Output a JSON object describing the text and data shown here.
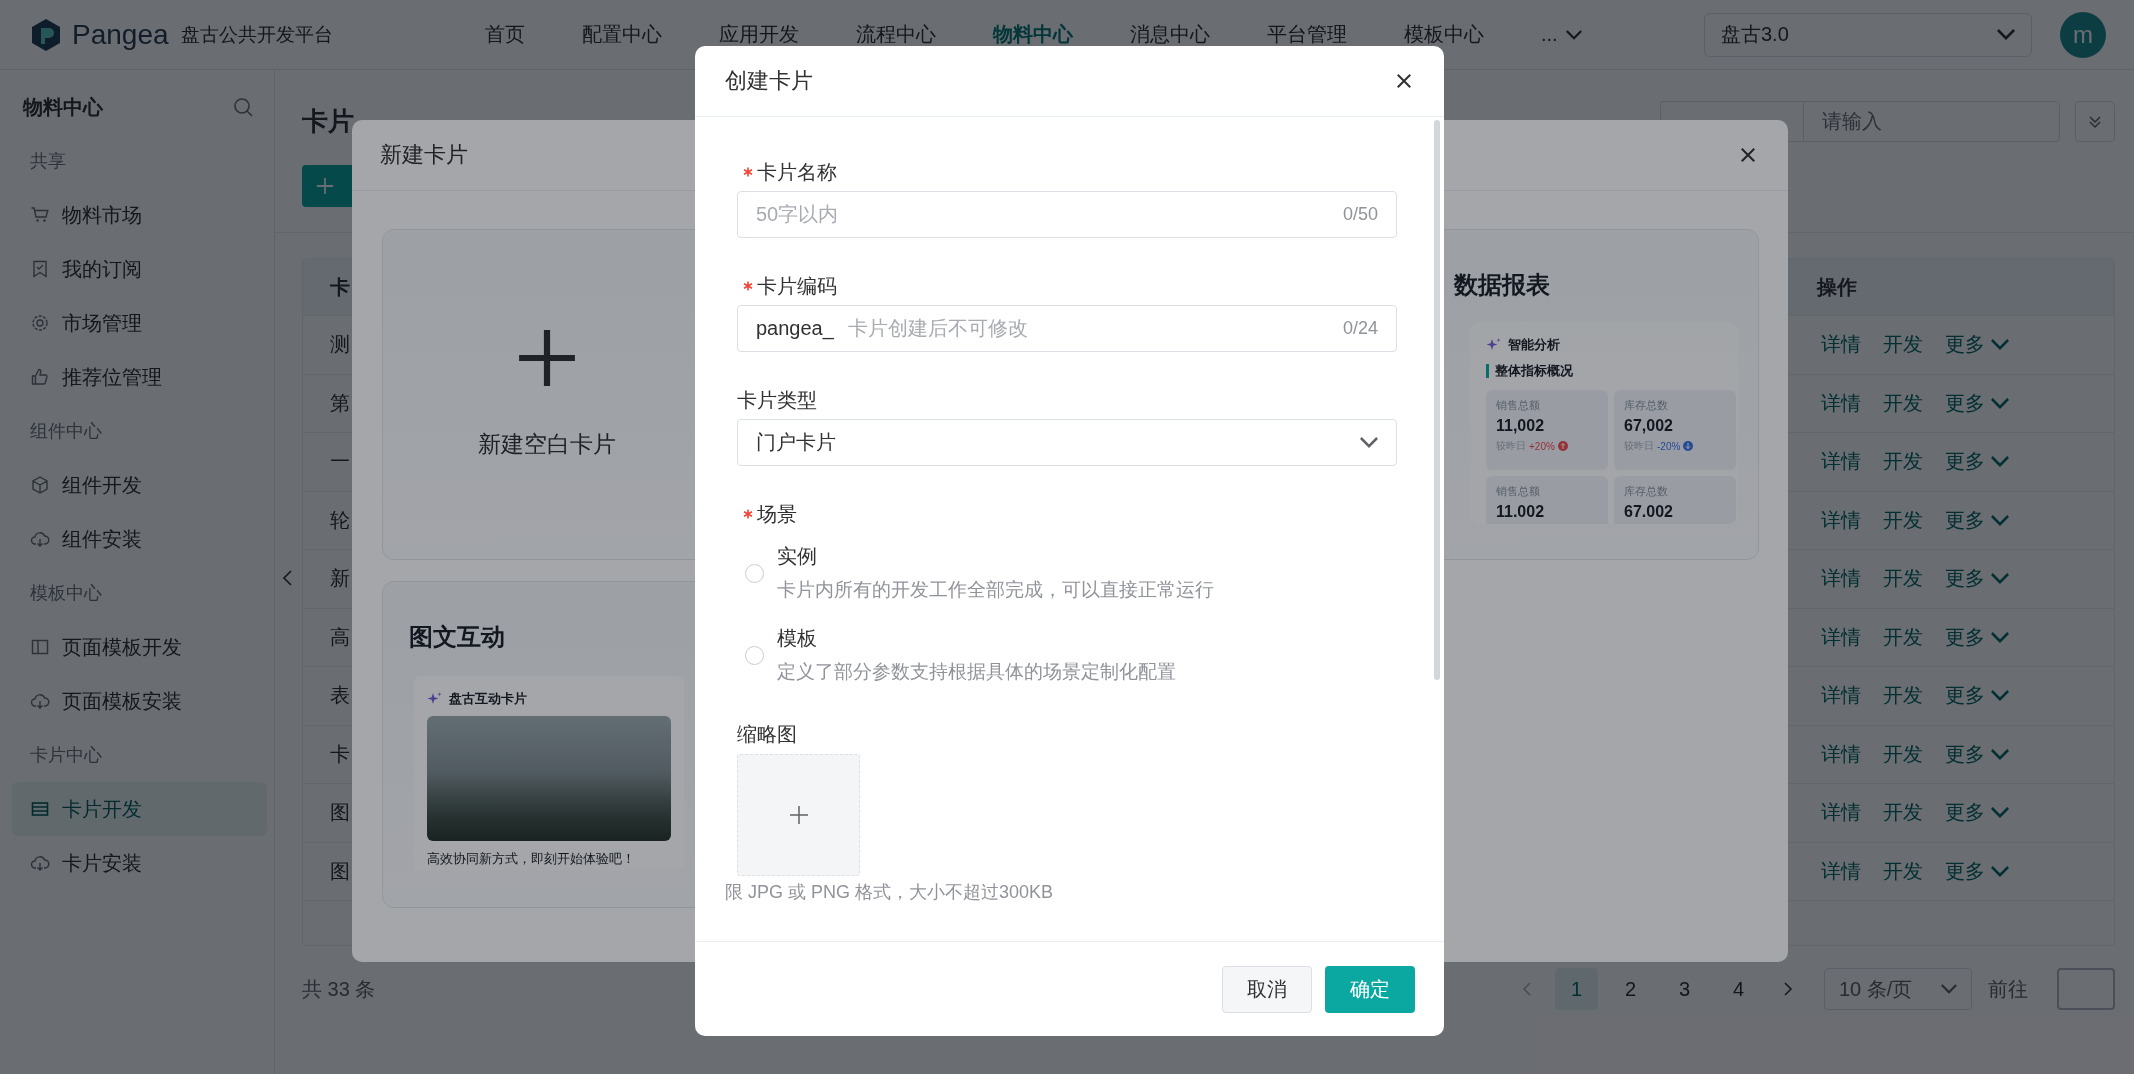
{
  "header": {
    "brand": "Pangea",
    "platform": "盘古公共开发平台",
    "nav": [
      {
        "label": "首页",
        "selected": false
      },
      {
        "label": "配置中心",
        "selected": false
      },
      {
        "label": "应用开发",
        "selected": false
      },
      {
        "label": "流程中心",
        "selected": false
      },
      {
        "label": "物料中心",
        "selected": true
      },
      {
        "label": "消息中心",
        "selected": false
      },
      {
        "label": "平台管理",
        "selected": false
      },
      {
        "label": "模板中心",
        "selected": false
      }
    ],
    "more": "...",
    "version_select": "盘古3.0",
    "avatar": "m"
  },
  "sidebar": {
    "title": "物料中心",
    "groups": [
      {
        "label": "共享",
        "items": [
          {
            "label": "物料市场",
            "selected": false
          },
          {
            "label": "我的订阅",
            "selected": false
          },
          {
            "label": "市场管理",
            "selected": false
          },
          {
            "label": "推荐位管理",
            "selected": false
          }
        ]
      },
      {
        "label": "组件中心",
        "items": [
          {
            "label": "组件开发",
            "selected": false
          },
          {
            "label": "组件安装",
            "selected": false
          }
        ]
      },
      {
        "label": "模板中心",
        "items": [
          {
            "label": "页面模板开发",
            "selected": false
          },
          {
            "label": "页面模板安装",
            "selected": false
          }
        ]
      },
      {
        "label": "卡片中心",
        "items": [
          {
            "label": "卡片开发",
            "selected": true
          },
          {
            "label": "卡片安装",
            "selected": false
          }
        ]
      }
    ]
  },
  "main": {
    "title": "卡片",
    "filter": {
      "placeholder": "请输入"
    },
    "table": {
      "columns": [
        "卡",
        "操作"
      ],
      "rows": [
        {
          "column_1": "测",
          "actions": [
            "详情",
            "开发",
            "更多"
          ]
        },
        {
          "column_1": "第",
          "actions": [
            "详情",
            "开发",
            "更多"
          ]
        },
        {
          "column_1": "一",
          "actions": [
            "详情",
            "开发",
            "更多"
          ]
        },
        {
          "column_1": "轮",
          "actions": [
            "详情",
            "开发",
            "更多"
          ]
        },
        {
          "column_1": "新",
          "actions": [
            "详情",
            "开发",
            "更多"
          ]
        },
        {
          "column_1": "高",
          "actions": [
            "详情",
            "开发",
            "更多"
          ]
        },
        {
          "column_1": "表",
          "actions": [
            "详情",
            "开发",
            "更多"
          ]
        },
        {
          "column_1": "卡",
          "actions": [
            "详情",
            "开发",
            "更多"
          ]
        },
        {
          "column_1": "图",
          "actions": [
            "详情",
            "开发",
            "更多"
          ]
        },
        {
          "column_1": "图",
          "actions": [
            "详情",
            "开发",
            "更多"
          ]
        }
      ]
    },
    "total": "共 33 条",
    "pagination": {
      "pages": [
        {
          "label": "1",
          "selected": true
        },
        {
          "label": "2",
          "selected": false
        },
        {
          "label": "3",
          "selected": false
        },
        {
          "label": "4",
          "selected": false
        }
      ],
      "page_size": "10 条/页",
      "jump_label": "前往"
    }
  },
  "gallery_dialog": {
    "title": "新建卡片",
    "cards": [
      {
        "kind": "blank",
        "label": "新建空白卡片"
      },
      {
        "kind": "report",
        "title": "数据报表",
        "preview_title": "智能分析",
        "section": "整体指标概况",
        "metrics": [
          {
            "label": "销售总额",
            "value": "11,002",
            "compare": "较昨日",
            "change": "+20%",
            "rising": true
          },
          {
            "label": "库存总数",
            "value": "67,002",
            "compare": "较昨日",
            "change": "-20%",
            "rising": false
          },
          {
            "label": "销售总额",
            "value": "11.002"
          },
          {
            "label": "库存总数",
            "value": "67.002"
          }
        ]
      },
      {
        "kind": "image",
        "title": "图文互动",
        "preview_title": "盘古互动卡片",
        "caption": "高效协同新方式，即刻开始体验吧！"
      }
    ]
  },
  "create_dialog": {
    "title": "创建卡片",
    "fields": [
      {
        "kind": "text",
        "label": "卡片名称",
        "required": true,
        "placeholder": "50字以内",
        "counter": "0/50"
      },
      {
        "kind": "text",
        "label": "卡片编码",
        "required": true,
        "prefix": "pangea_",
        "placeholder": "卡片创建后不可修改",
        "counter": "0/24"
      },
      {
        "kind": "select",
        "label": "卡片类型",
        "required": false,
        "value": "门户卡片"
      },
      {
        "kind": "radio",
        "label": "场景",
        "required": true,
        "options": [
          {
            "label": "实例",
            "description": "卡片内所有的开发工作全部完成，可以直接正常运行",
            "selected": false
          },
          {
            "label": "模板",
            "description": "定义了部分参数支持根据具体的场景定制化配置",
            "selected": false
          }
        ]
      },
      {
        "kind": "upload",
        "label": "缩略图",
        "required": false,
        "hint": "限 JPG 或 PNG 格式，大小不超过300KB"
      }
    ],
    "buttons": [
      {
        "label": "取消",
        "kind": "secondary"
      },
      {
        "label": "确定",
        "kind": "primary"
      }
    ]
  }
}
